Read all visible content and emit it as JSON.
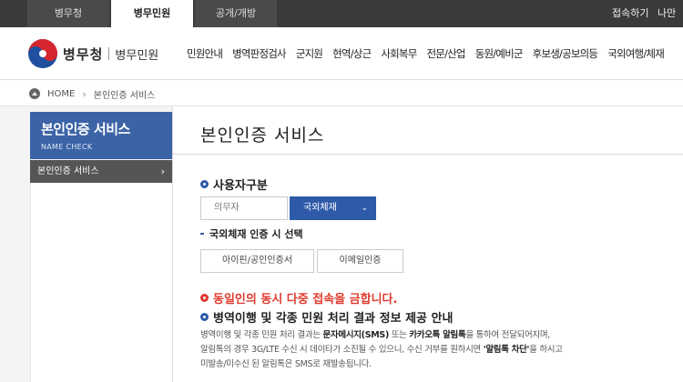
{
  "top_tabs": [
    "병무청",
    "병무민원",
    "공개/개방"
  ],
  "top_links": [
    "접속하기",
    "나만"
  ],
  "logo": {
    "main": "병무청",
    "sub": "병무민원"
  },
  "gnb": [
    "민원안내",
    "병역판정검사",
    "군지원",
    "현역/상근",
    "사회복무",
    "전문/산업",
    "동원/예비군",
    "후보생/공보의등",
    "국외여행/체재"
  ],
  "breadcrumb": {
    "home": "HOME",
    "current": "본인인증 서비스"
  },
  "sidebar": {
    "title": "본인인증 서비스",
    "subtitle": "NAME CHECK",
    "item": "본인인증 서비스",
    "item_arrow": "›"
  },
  "page_title": "본인인증 서비스",
  "user_type": {
    "heading": "사용자구분",
    "options": [
      "의무자",
      "국외체재"
    ],
    "selected": "국외체재",
    "dropdown_glyph": "⌄"
  },
  "auth_select": {
    "heading": "국외체재 인증 시 선택",
    "options": [
      "아이핀/공인인증서",
      "이메일인증"
    ]
  },
  "warning": "동일인의 동시 다중 접속을 금합니다.",
  "notice": {
    "heading": "병역이행 및 각종 민원 처리 결과 정보 제공 안내",
    "line1_pre": "병역이행 및 각종 민원 처리 결과는 ",
    "line1_b1": "문자메시지(SMS)",
    "line1_mid": " 또는 ",
    "line1_b2": "카카오톡 알림톡",
    "line1_post": "을 통하여 전달되어지며,",
    "line2_pre": "알림톡의 경우 3G/LTE 수신 시 데이타가 소진될 수 있으니, 수신 거부를 원하시면 ",
    "line2_b": "'알림톡 차단'",
    "line2_post": "을 하시고",
    "line3": "미발송/미수신 된 알림톡은 SMS로 재발송됩니다."
  },
  "colors": {
    "accent": "#2f5aa9",
    "warning": "#e03a2e",
    "topbar": "#3a3a3a"
  }
}
